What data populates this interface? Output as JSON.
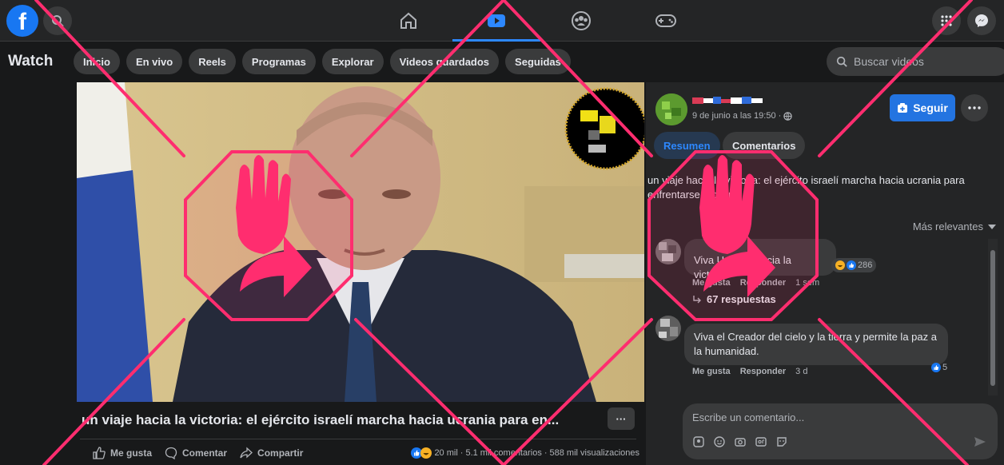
{
  "topbar": {
    "logo_letter": "f",
    "nav": [
      "home-icon",
      "watch-icon",
      "groups-icon",
      "gaming-icon"
    ]
  },
  "watch": {
    "title": "Watch",
    "chips": [
      "Inicio",
      "En vivo",
      "Reels",
      "Programas",
      "Explorar",
      "Videos guardados",
      "Seguidas"
    ],
    "search_placeholder": "Buscar videos"
  },
  "video": {
    "title": "un viaje hacia la victoria: el ejército israelí marcha hacia ucrania para en...",
    "more": "···",
    "actions": {
      "like": "Me gusta",
      "comment": "Comentar",
      "share": "Compartir"
    },
    "stats": {
      "reactions": "20 mil",
      "comments": "5.1 mil comentarios",
      "views": "588 mil visualizaciones",
      "sep": "·"
    }
  },
  "post": {
    "date": "9 de junio a las 19:50 ·",
    "follow": "Seguir",
    "tabs": {
      "summary": "Resumen",
      "comments": "Comentarios"
    },
    "description": "un viaje hacia la victoria: el ejército israelí marcha hacia ucrania para enfrentarse a putin",
    "sort": "Más relevantes"
  },
  "comments": [
    {
      "text": "Viva Ucrania hacia la victoria",
      "reactions": "286",
      "like": "Me gusta",
      "reply": "Responder",
      "time": "1 sem",
      "replies": "67 respuestas"
    },
    {
      "text": "Viva el Creador del cielo y la tierra y permite la paz a la humanidad.",
      "reactions": "5",
      "like": "Me gusta",
      "reply": "Responder",
      "time": "3 d"
    }
  ],
  "composer": {
    "placeholder": "Escribe un comentario..."
  },
  "colors": {
    "overlay": "#ff2d6f",
    "accent": "#2d88ff",
    "brand": "#1877f2"
  }
}
